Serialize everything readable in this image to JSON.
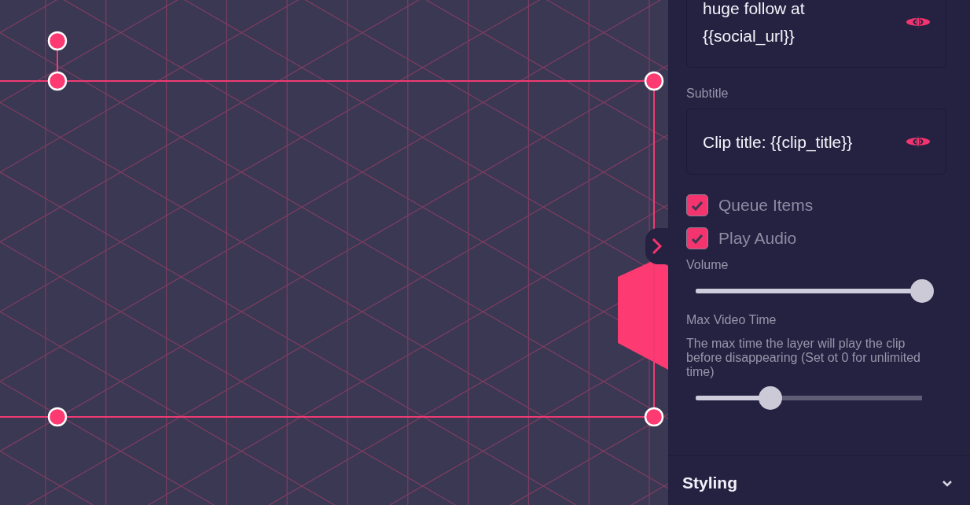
{
  "message_field": {
    "value": "huge follow at\n{{social_url}}"
  },
  "subtitle_field": {
    "label": "Subtitle",
    "value": "Clip title: {{clip_title}}"
  },
  "options": [
    {
      "label": "Queue Items",
      "checked": true
    },
    {
      "label": "Play Audio",
      "checked": true
    }
  ],
  "volume": {
    "label": "Volume",
    "level": 1.0
  },
  "max_video_time": {
    "label": "Max Video Time",
    "description": "The max time the layer will play the clip before disappearing (Set ot 0 for unlimited time)",
    "level": 0.33
  },
  "styling_section": {
    "title": "Styling",
    "expanded": false
  }
}
